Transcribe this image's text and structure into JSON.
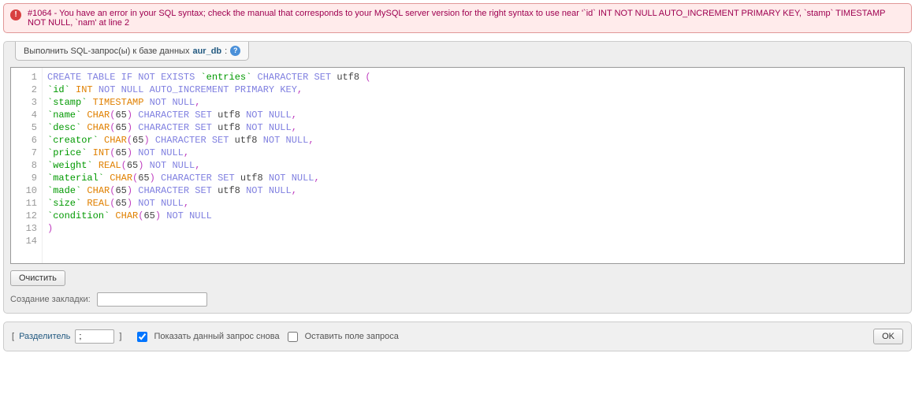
{
  "error": {
    "text": "#1064 - You have an error in your SQL syntax; check the manual that corresponds to your MySQL server version for the right syntax to use near '`id` INT NOT NULL AUTO_INCREMENT PRIMARY KEY, `stamp` TIMESTAMP NOT NULL, `nam' at line 2"
  },
  "tab": {
    "prefix": "Выполнить SQL-запрос(ы) к базе данных ",
    "db": "aur_db",
    "suffix": ":"
  },
  "sql": {
    "lines": [
      [
        {
          "c": "kw",
          "t": "CREATE"
        },
        {
          "c": "",
          "t": " "
        },
        {
          "c": "kw",
          "t": "TABLE"
        },
        {
          "c": "",
          "t": " "
        },
        {
          "c": "kw",
          "t": "IF"
        },
        {
          "c": "",
          "t": " "
        },
        {
          "c": "kw",
          "t": "NOT"
        },
        {
          "c": "",
          "t": " "
        },
        {
          "c": "kw",
          "t": "EXISTS"
        },
        {
          "c": "",
          "t": " "
        },
        {
          "c": "str",
          "t": "`entries`"
        },
        {
          "c": "",
          "t": " "
        },
        {
          "c": "kw",
          "t": "CHARACTER"
        },
        {
          "c": "",
          "t": " "
        },
        {
          "c": "kw",
          "t": "SET"
        },
        {
          "c": "",
          "t": " utf8 "
        },
        {
          "c": "par",
          "t": "("
        }
      ],
      [
        {
          "c": "str",
          "t": "`id`"
        },
        {
          "c": "",
          "t": " "
        },
        {
          "c": "fn",
          "t": "INT"
        },
        {
          "c": "",
          "t": " "
        },
        {
          "c": "kw",
          "t": "NOT"
        },
        {
          "c": "",
          "t": " "
        },
        {
          "c": "kw",
          "t": "NULL"
        },
        {
          "c": "",
          "t": " "
        },
        {
          "c": "kw",
          "t": "AUTO_INCREMENT"
        },
        {
          "c": "",
          "t": " "
        },
        {
          "c": "kw",
          "t": "PRIMARY"
        },
        {
          "c": "",
          "t": " "
        },
        {
          "c": "kw",
          "t": "KEY"
        },
        {
          "c": "par",
          "t": ","
        }
      ],
      [
        {
          "c": "str",
          "t": "`stamp`"
        },
        {
          "c": "",
          "t": " "
        },
        {
          "c": "fn",
          "t": "TIMESTAMP"
        },
        {
          "c": "",
          "t": " "
        },
        {
          "c": "kw",
          "t": "NOT"
        },
        {
          "c": "",
          "t": " "
        },
        {
          "c": "kw",
          "t": "NULL"
        },
        {
          "c": "par",
          "t": ","
        }
      ],
      [
        {
          "c": "str",
          "t": "`name`"
        },
        {
          "c": "",
          "t": " "
        },
        {
          "c": "fn",
          "t": "CHAR"
        },
        {
          "c": "par",
          "t": "("
        },
        {
          "c": "",
          "t": "65"
        },
        {
          "c": "par",
          "t": ")"
        },
        {
          "c": "",
          "t": " "
        },
        {
          "c": "kw",
          "t": "CHARACTER"
        },
        {
          "c": "",
          "t": " "
        },
        {
          "c": "kw",
          "t": "SET"
        },
        {
          "c": "",
          "t": " utf8 "
        },
        {
          "c": "kw",
          "t": "NOT"
        },
        {
          "c": "",
          "t": " "
        },
        {
          "c": "kw",
          "t": "NULL"
        },
        {
          "c": "par",
          "t": ","
        }
      ],
      [
        {
          "c": "str",
          "t": "`desc`"
        },
        {
          "c": "",
          "t": " "
        },
        {
          "c": "fn",
          "t": "CHAR"
        },
        {
          "c": "par",
          "t": "("
        },
        {
          "c": "",
          "t": "65"
        },
        {
          "c": "par",
          "t": ")"
        },
        {
          "c": "",
          "t": " "
        },
        {
          "c": "kw",
          "t": "CHARACTER"
        },
        {
          "c": "",
          "t": " "
        },
        {
          "c": "kw",
          "t": "SET"
        },
        {
          "c": "",
          "t": " utf8 "
        },
        {
          "c": "kw",
          "t": "NOT"
        },
        {
          "c": "",
          "t": " "
        },
        {
          "c": "kw",
          "t": "NULL"
        },
        {
          "c": "par",
          "t": ","
        }
      ],
      [
        {
          "c": "str",
          "t": "`creator`"
        },
        {
          "c": "",
          "t": " "
        },
        {
          "c": "fn",
          "t": "CHAR"
        },
        {
          "c": "par",
          "t": "("
        },
        {
          "c": "",
          "t": "65"
        },
        {
          "c": "par",
          "t": ")"
        },
        {
          "c": "",
          "t": " "
        },
        {
          "c": "kw",
          "t": "CHARACTER"
        },
        {
          "c": "",
          "t": " "
        },
        {
          "c": "kw",
          "t": "SET"
        },
        {
          "c": "",
          "t": " utf8 "
        },
        {
          "c": "kw",
          "t": "NOT"
        },
        {
          "c": "",
          "t": " "
        },
        {
          "c": "kw",
          "t": "NULL"
        },
        {
          "c": "par",
          "t": ","
        }
      ],
      [
        {
          "c": "str",
          "t": "`price`"
        },
        {
          "c": "",
          "t": " "
        },
        {
          "c": "fn",
          "t": "INT"
        },
        {
          "c": "par",
          "t": "("
        },
        {
          "c": "",
          "t": "65"
        },
        {
          "c": "par",
          "t": ")"
        },
        {
          "c": "",
          "t": " "
        },
        {
          "c": "kw",
          "t": "NOT"
        },
        {
          "c": "",
          "t": " "
        },
        {
          "c": "kw",
          "t": "NULL"
        },
        {
          "c": "par",
          "t": ","
        }
      ],
      [
        {
          "c": "str",
          "t": "`weight`"
        },
        {
          "c": "",
          "t": " "
        },
        {
          "c": "fn",
          "t": "REAL"
        },
        {
          "c": "par",
          "t": "("
        },
        {
          "c": "",
          "t": "65"
        },
        {
          "c": "par",
          "t": ")"
        },
        {
          "c": "",
          "t": " "
        },
        {
          "c": "kw",
          "t": "NOT"
        },
        {
          "c": "",
          "t": " "
        },
        {
          "c": "kw",
          "t": "NULL"
        },
        {
          "c": "par",
          "t": ","
        }
      ],
      [
        {
          "c": "str",
          "t": "`material`"
        },
        {
          "c": "",
          "t": " "
        },
        {
          "c": "fn",
          "t": "CHAR"
        },
        {
          "c": "par",
          "t": "("
        },
        {
          "c": "",
          "t": "65"
        },
        {
          "c": "par",
          "t": ")"
        },
        {
          "c": "",
          "t": " "
        },
        {
          "c": "kw",
          "t": "CHARACTER"
        },
        {
          "c": "",
          "t": " "
        },
        {
          "c": "kw",
          "t": "SET"
        },
        {
          "c": "",
          "t": " utf8 "
        },
        {
          "c": "kw",
          "t": "NOT"
        },
        {
          "c": "",
          "t": " "
        },
        {
          "c": "kw",
          "t": "NULL"
        },
        {
          "c": "par",
          "t": ","
        }
      ],
      [
        {
          "c": "str",
          "t": "`made`"
        },
        {
          "c": "",
          "t": " "
        },
        {
          "c": "fn",
          "t": "CHAR"
        },
        {
          "c": "par",
          "t": "("
        },
        {
          "c": "",
          "t": "65"
        },
        {
          "c": "par",
          "t": ")"
        },
        {
          "c": "",
          "t": " "
        },
        {
          "c": "kw",
          "t": "CHARACTER"
        },
        {
          "c": "",
          "t": " "
        },
        {
          "c": "kw",
          "t": "SET"
        },
        {
          "c": "",
          "t": " utf8 "
        },
        {
          "c": "kw",
          "t": "NOT"
        },
        {
          "c": "",
          "t": " "
        },
        {
          "c": "kw",
          "t": "NULL"
        },
        {
          "c": "par",
          "t": ","
        }
      ],
      [
        {
          "c": "str",
          "t": "`size`"
        },
        {
          "c": "",
          "t": " "
        },
        {
          "c": "fn",
          "t": "REAL"
        },
        {
          "c": "par",
          "t": "("
        },
        {
          "c": "",
          "t": "65"
        },
        {
          "c": "par",
          "t": ")"
        },
        {
          "c": "",
          "t": " "
        },
        {
          "c": "kw",
          "t": "NOT"
        },
        {
          "c": "",
          "t": " "
        },
        {
          "c": "kw",
          "t": "NULL"
        },
        {
          "c": "par",
          "t": ","
        }
      ],
      [
        {
          "c": "str",
          "t": "`condition`"
        },
        {
          "c": "",
          "t": " "
        },
        {
          "c": "fn",
          "t": "CHAR"
        },
        {
          "c": "par",
          "t": "("
        },
        {
          "c": "",
          "t": "65"
        },
        {
          "c": "par",
          "t": ")"
        },
        {
          "c": "",
          "t": " "
        },
        {
          "c": "kw",
          "t": "NOT"
        },
        {
          "c": "",
          "t": " "
        },
        {
          "c": "kw",
          "t": "NULL"
        }
      ],
      [
        {
          "c": "par",
          "t": ")"
        }
      ],
      []
    ]
  },
  "buttons": {
    "clear": "Очистить",
    "ok": "OK"
  },
  "bookmark": {
    "label": "Создание закладки:",
    "value": ""
  },
  "footer": {
    "delimiter_label_open": "[ ",
    "delimiter_link": "Разделитель",
    "delimiter_value": ";",
    "delimiter_label_close": " ]",
    "show_again_label": " Показать данный запрос снова ",
    "show_again_checked": true,
    "keep_query_label": " Оставить поле запроса",
    "keep_query_checked": false
  }
}
